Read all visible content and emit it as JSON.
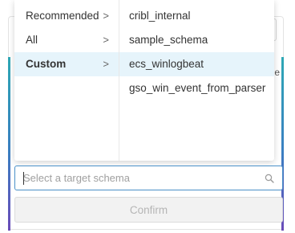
{
  "background": {
    "clipped_text": "e"
  },
  "dropdown": {
    "categories": [
      {
        "label": "Recommended",
        "chevron": ">"
      },
      {
        "label": "All",
        "chevron": ">"
      },
      {
        "label": "Custom",
        "chevron": ">"
      }
    ],
    "active_category": "Custom",
    "schemas": [
      {
        "label": "cribl_internal"
      },
      {
        "label": "sample_schema"
      },
      {
        "label": "ecs_winlogbeat"
      },
      {
        "label": "gso_win_event_from_parser"
      }
    ],
    "highlighted_schema": "ecs_winlogbeat"
  },
  "search": {
    "placeholder": "Select a target schema",
    "value": ""
  },
  "confirm": {
    "label": "Confirm",
    "disabled": true
  },
  "colors": {
    "accent": "#4a90c8",
    "highlight": "#e6f4fb",
    "disabled_text": "#b5b5b5"
  }
}
